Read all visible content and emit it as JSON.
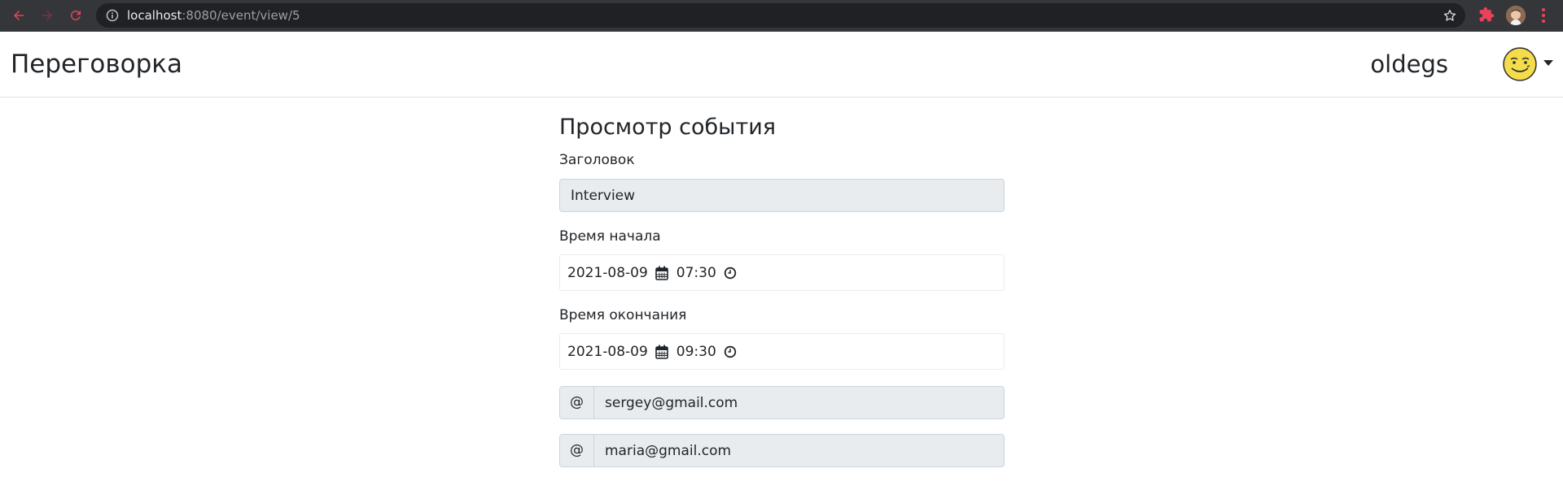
{
  "browser": {
    "url_host": "localhost",
    "url_path": ":8080/event/view/5"
  },
  "header": {
    "brand": "Переговорка",
    "username": "oldegs"
  },
  "main": {
    "title": "Просмотр события",
    "title_label": "Заголовок",
    "title_value": "Interview",
    "start_label": "Время начала",
    "start_date": "2021-08-09",
    "start_time": "07:30",
    "end_label": "Время окончания",
    "end_date": "2021-08-09",
    "end_time": "09:30",
    "participants": [
      {
        "prefix": "@",
        "email": "sergey@gmail.com"
      },
      {
        "prefix": "@",
        "email": "maria@gmail.com"
      }
    ]
  },
  "colors": {
    "chrome_bg": "#35363a",
    "omnibox_bg": "#202124",
    "readonly_bg": "#e9ecef",
    "border": "#ced4da",
    "nav_back": "#e8435a"
  },
  "icons": [
    "back-arrow-icon",
    "forward-arrow-icon",
    "reload-icon",
    "info-icon",
    "star-icon",
    "extension-icon",
    "calendar-icon",
    "clock-icon",
    "caret-down-icon",
    "more-vertical-icon"
  ]
}
